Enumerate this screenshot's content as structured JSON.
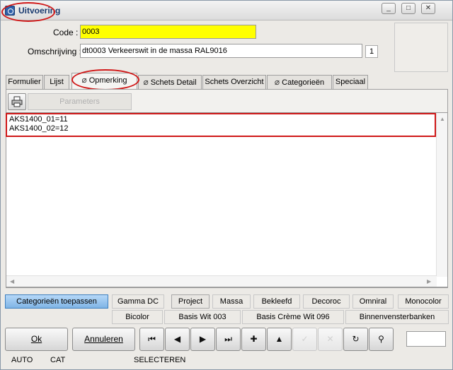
{
  "window": {
    "title": "Uitvoering",
    "minimize": "_",
    "maximize": "□",
    "close": "✕"
  },
  "form": {
    "code_label": "Code :",
    "code_value": "0003",
    "desc_label": "Omschrijving :",
    "desc_value": "dt0003 Verkeerswit in de massa RAL9016",
    "desc_count": "1"
  },
  "tabs": [
    "Formulier",
    "Lijst",
    "Opmerking",
    "Schets Detail",
    "Schets Overzicht",
    "Categorieën",
    "Speciaal"
  ],
  "toolbar": {
    "parameters_label": "Parameters"
  },
  "memo": {
    "lines": [
      "AKS1400_01=11",
      "AKS1400_02=12"
    ]
  },
  "filters_row1": [
    "Categorieën toepassen",
    "Gamma DC",
    "Project",
    "Massa",
    "Bekleefd",
    "Decoroc",
    "Omniral",
    "Monocolor"
  ],
  "filters_row2": [
    "Bicolor",
    "Basis Wit 003",
    "Basis Crème Wit 096",
    "Binnenvensterbanken"
  ],
  "buttons": {
    "ok": "Ok",
    "cancel": "Annuleren"
  },
  "nav": {
    "first": "⏮",
    "prev": "◀",
    "next": "▶",
    "last": "⏭",
    "add": "✚",
    "up": "▲",
    "confirm": "✓",
    "delete": "✕",
    "refresh": "↻",
    "find": "⚲"
  },
  "status": {
    "auto": "AUTO",
    "cat": "CAT",
    "mode": "SELECTEREN"
  },
  "colors": {
    "highlight": "#ffff00",
    "annotation": "#d01818",
    "accent": "#7fb4e6"
  }
}
